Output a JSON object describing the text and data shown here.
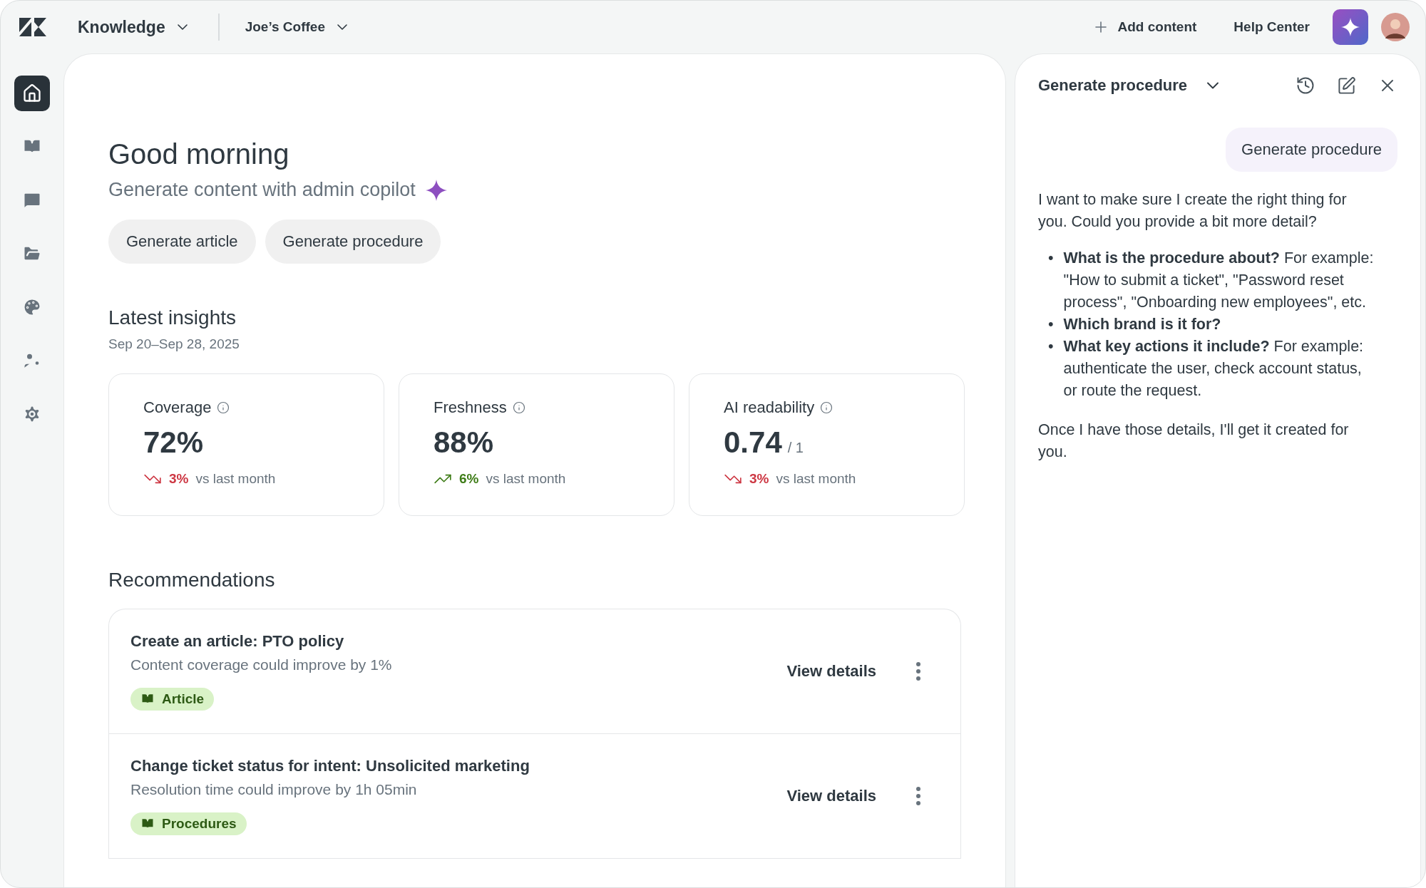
{
  "top_bar": {
    "product": "Knowledge",
    "brand": "Joe’s Coffee",
    "add_content": "Add content",
    "help_center": "Help Center"
  },
  "sidebar": {
    "items": [
      {
        "kind": "home",
        "selected": true
      },
      {
        "kind": "book",
        "selected": false
      },
      {
        "kind": "review",
        "selected": false
      },
      {
        "kind": "folders",
        "selected": false
      },
      {
        "kind": "palette",
        "selected": false
      },
      {
        "kind": "user",
        "selected": false
      },
      {
        "kind": "settings",
        "selected": false
      }
    ]
  },
  "main": {
    "greeting": "Good morning",
    "subtitle": "Generate content with admin copilot",
    "actions": [
      "Generate article",
      "Generate procedure"
    ],
    "insights": {
      "title": "Latest insights",
      "dates": "Sep 20–Sep 28, 2025",
      "metrics": [
        {
          "label": "Coverage",
          "value": "72%",
          "rising": false,
          "change": "3%",
          "compare": "vs last month"
        },
        {
          "label": "Freshness",
          "value": "88%",
          "rising": true,
          "change": "6%",
          "compare": "vs last month"
        },
        {
          "label": "AI readability",
          "value": "0.74",
          "suffix": "/ 1",
          "rising": false,
          "change": "3%",
          "compare": "vs last month"
        }
      ]
    },
    "recommendations": {
      "title": "Recommendations",
      "items": [
        {
          "title": "Create an article: PTO policy",
          "detail": "Content coverage could improve by 1%",
          "tag": "Article",
          "action": "View details"
        },
        {
          "title": "Change ticket status for intent: Unsolicited marketing",
          "detail": "Resolution time could improve by 1h 05min",
          "tag": "Procedures",
          "action": "View details"
        }
      ]
    }
  },
  "copilot": {
    "title": "Generate procedure",
    "messages": [
      {
        "kind": "user",
        "text": "Generate procedure"
      },
      {
        "kind": "assistant",
        "intro": "I want to make sure I create the right thing for you. Could you provide a bit more detail?",
        "bullets": [
          {
            "marker": "•",
            "text": "**What is the procedure about?** For example: \"How to submit a ticket\", \"Password reset process\", \"Onboarding new employees\", etc."
          },
          {
            "marker": "•",
            "text": "**Which brand is it for?**"
          },
          {
            "marker": "•",
            "text": "**What key actions it include?** For example: authenticate the user, check account status, or route the request."
          }
        ],
        "outro": "Once I have those details, I'll get it created for you."
      }
    ]
  }
}
